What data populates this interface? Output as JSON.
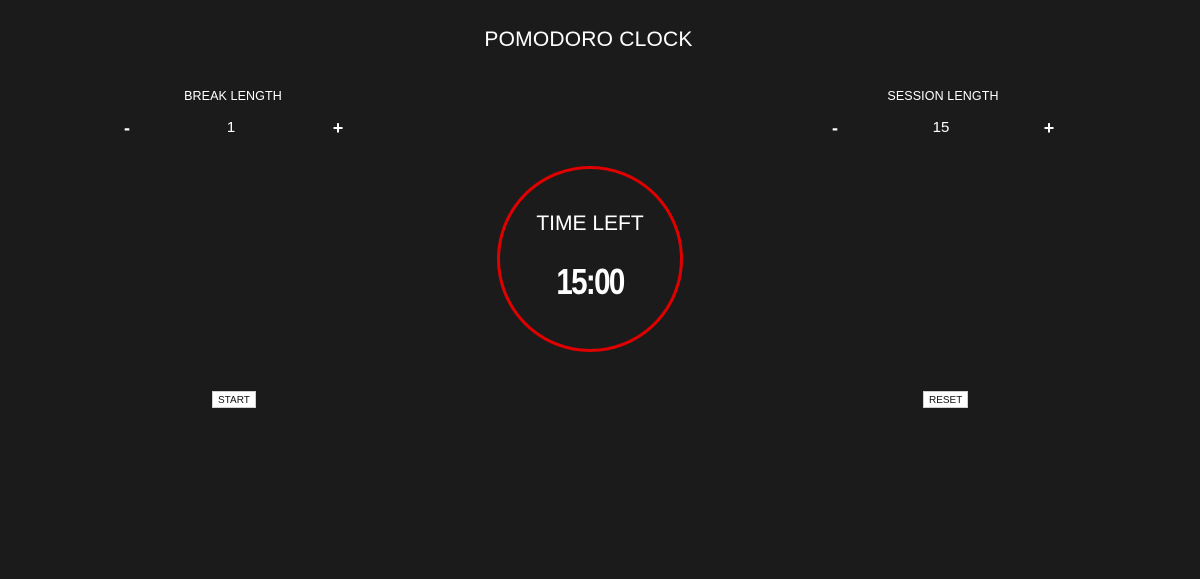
{
  "header": {
    "title": "POMODORO CLOCK"
  },
  "break_panel": {
    "label": "BREAK LENGTH",
    "decrement": "-",
    "value": "1",
    "increment": "+"
  },
  "session_panel": {
    "label": "SESSION LENGTH",
    "decrement": "-",
    "value": "15",
    "increment": "+"
  },
  "timer": {
    "label": "TIME LEFT",
    "value": "15:00",
    "ring_color": "#e10000"
  },
  "controls": {
    "start_label": "START",
    "reset_label": "RESET"
  },
  "colors": {
    "background": "#1b1b1b",
    "text": "#ffffff",
    "accent": "#e10000"
  }
}
